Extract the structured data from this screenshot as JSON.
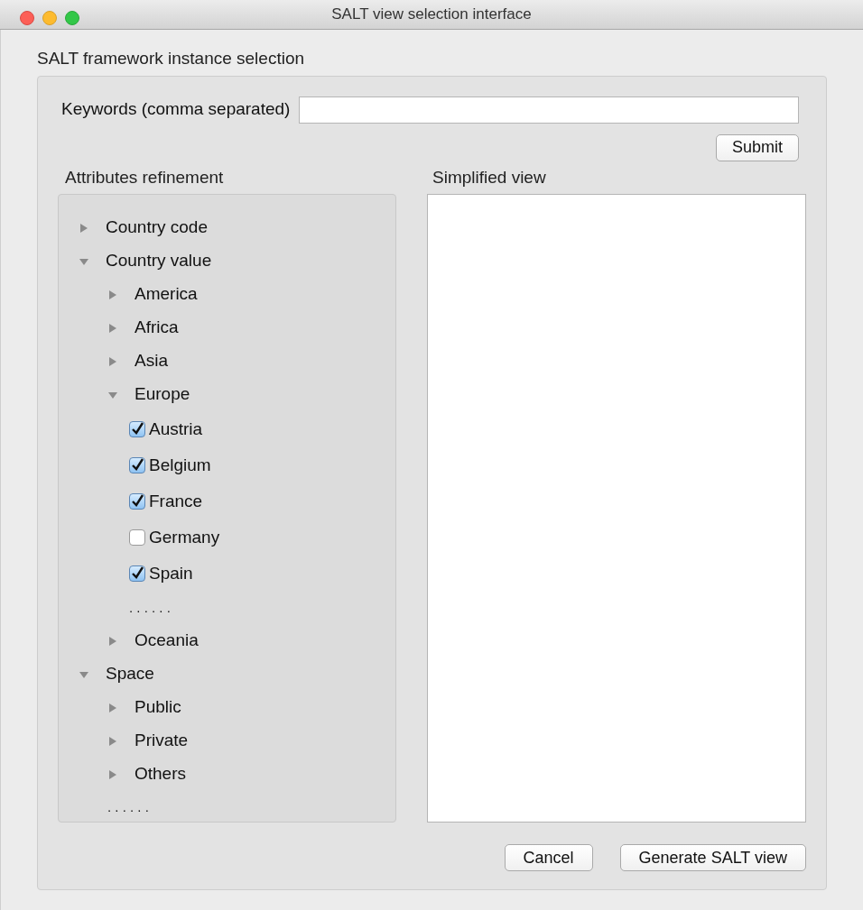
{
  "window": {
    "title": "SALT view selection interface"
  },
  "group": {
    "title": "SALT framework instance selection"
  },
  "keywords": {
    "label": "Keywords (comma separated)"
  },
  "submit": "Submit",
  "attributes": {
    "title": "Attributes refinement",
    "tree": [
      {
        "kind": "branch",
        "label": "Country code",
        "expanded": false
      },
      {
        "kind": "branch",
        "label": "Country value",
        "expanded": true,
        "children": [
          {
            "kind": "branch",
            "label": "America",
            "expanded": false
          },
          {
            "kind": "branch",
            "label": "Africa",
            "expanded": false
          },
          {
            "kind": "branch",
            "label": "Asia",
            "expanded": false
          },
          {
            "kind": "branch",
            "label": "Europe",
            "expanded": true,
            "children": [
              {
                "kind": "check",
                "label": "Austria",
                "checked": true
              },
              {
                "kind": "check",
                "label": "Belgium",
                "checked": true
              },
              {
                "kind": "check",
                "label": "France",
                "checked": true
              },
              {
                "kind": "check",
                "label": "Germany",
                "checked": false
              },
              {
                "kind": "check",
                "label": "Spain",
                "checked": true
              },
              {
                "kind": "more",
                "label": ". . . . . ."
              }
            ]
          },
          {
            "kind": "branch",
            "label": "Oceania",
            "expanded": false
          }
        ]
      },
      {
        "kind": "branch",
        "label": "Space",
        "expanded": true,
        "children": [
          {
            "kind": "branch",
            "label": "Public",
            "expanded": false
          },
          {
            "kind": "branch",
            "label": "Private",
            "expanded": false
          },
          {
            "kind": "branch",
            "label": "Others",
            "expanded": false
          },
          {
            "kind": "more",
            "label": ". . . . . ."
          }
        ]
      }
    ]
  },
  "simplified": {
    "title": "Simplified view"
  },
  "buttons": [
    "Cancel",
    "Generate SALT view"
  ]
}
